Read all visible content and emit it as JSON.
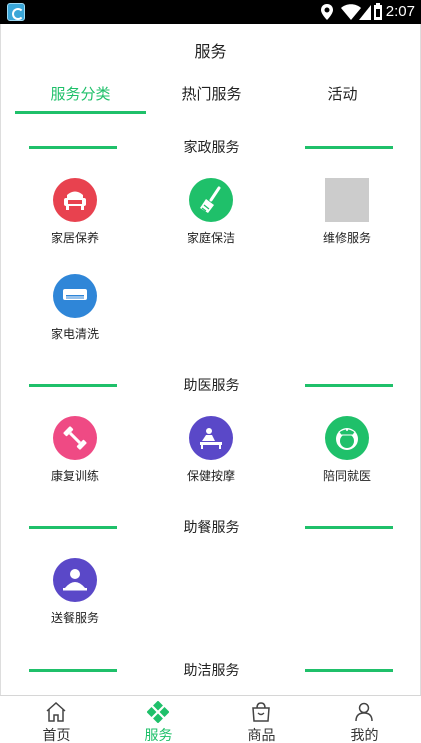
{
  "status_bar": {
    "time": "2:07"
  },
  "header": {
    "title": "服务"
  },
  "tabs": [
    {
      "label": "服务分类",
      "active": true
    },
    {
      "label": "热门服务",
      "active": false
    },
    {
      "label": "活动",
      "active": false
    }
  ],
  "sections": [
    {
      "title": "家政服务",
      "items": [
        {
          "label": "家居保养",
          "icon": "sofa-icon",
          "color": "#e8424f"
        },
        {
          "label": "家庭保洁",
          "icon": "broom-icon",
          "color": "#1fc06a"
        },
        {
          "label": "维修服务",
          "icon": "image-placeholder-icon",
          "color": "#cccccc"
        },
        {
          "label": "家电清洗",
          "icon": "air-conditioner-icon",
          "color": "#2f86d8"
        }
      ]
    },
    {
      "title": "助医服务",
      "items": [
        {
          "label": "康复训练",
          "icon": "dumbbell-icon",
          "color": "#ef4a84"
        },
        {
          "label": "保健按摩",
          "icon": "massage-icon",
          "color": "#5a48c8"
        },
        {
          "label": "陪同就医",
          "icon": "nurse-icon",
          "color": "#1fc06a"
        }
      ]
    },
    {
      "title": "助餐服务",
      "items": [
        {
          "label": "送餐服务",
          "icon": "meal-delivery-icon",
          "color": "#5a48c8"
        }
      ]
    },
    {
      "title": "助洁服务",
      "items": []
    }
  ],
  "bottom_nav": [
    {
      "label": "首页",
      "icon": "home-icon",
      "active": false
    },
    {
      "label": "服务",
      "icon": "service-icon",
      "active": true
    },
    {
      "label": "商品",
      "icon": "shopping-bag-icon",
      "active": false
    },
    {
      "label": "我的",
      "icon": "person-icon",
      "active": false
    }
  ],
  "colors": {
    "accent": "#1fc06a",
    "placeholder": "#cccccc"
  }
}
